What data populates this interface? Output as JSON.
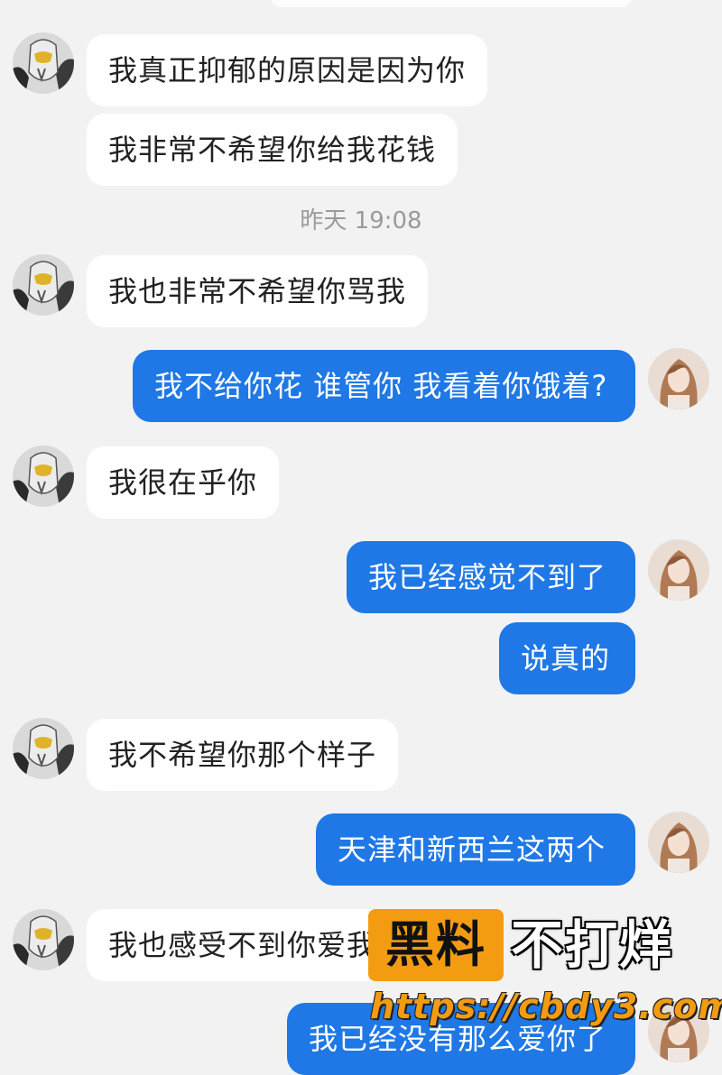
{
  "colors": {
    "background": "#f2f2f2",
    "incoming_bubble": "#ffffff",
    "outgoing_bubble": "#1f78e6",
    "timestamp_text": "#9a9a9a",
    "watermark_orange": "#f39c12"
  },
  "contact_avatar_icon": "masked-hero-avatar-icon",
  "self_avatar_icon": "user-photo-avatar-icon",
  "timestamp": "昨天 19:08",
  "messages": [
    {
      "direction": "incoming",
      "text": "我真正抑郁的原因是因为你"
    },
    {
      "direction": "incoming",
      "text": "我非常不希望你给我花钱"
    },
    {
      "direction": "incoming",
      "text": "我也非常不希望你骂我"
    },
    {
      "direction": "outgoing",
      "text": "我不给你花 谁管你 我看着你饿着?"
    },
    {
      "direction": "incoming",
      "text": "我很在乎你"
    },
    {
      "direction": "outgoing",
      "text": "我已经感觉不到了"
    },
    {
      "direction": "outgoing",
      "text": "说真的"
    },
    {
      "direction": "incoming",
      "text": "我不希望你那个样子"
    },
    {
      "direction": "outgoing",
      "text": "天津和新西兰这两个"
    },
    {
      "direction": "incoming",
      "text": "我也感受不到你爱我"
    },
    {
      "direction": "outgoing",
      "text": "我已经没有那么爱你了"
    }
  ],
  "watermark": {
    "brand": "黑料",
    "slogan": "不打烊",
    "url": "https://cbdy3.com"
  }
}
